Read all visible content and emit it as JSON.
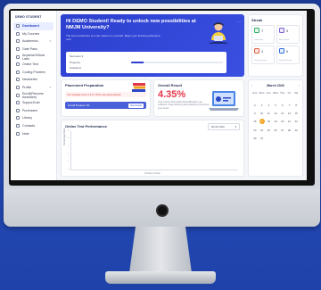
{
  "sidebar": {
    "brand": "DEMO STUDENT",
    "items": [
      {
        "label": "Dashboard",
        "active": true
      },
      {
        "label": "My Courses"
      },
      {
        "label": "Academics",
        "caret": true
      },
      {
        "label": "Gate Pass"
      },
      {
        "label": "Anydesk/Virtual Labs"
      },
      {
        "label": "Online Test"
      },
      {
        "label": "Coding Problem"
      },
      {
        "label": "Newsletter"
      },
      {
        "label": "Profile",
        "caret": true
      },
      {
        "label": "Enroll(Resume Assistant)"
      },
      {
        "label": "Support/Lab"
      },
      {
        "label": "Purchases"
      },
      {
        "label": "Library"
      },
      {
        "label": "Contacts"
      },
      {
        "label": "Note"
      }
    ]
  },
  "hero": {
    "title": "Hi DEMO Student! Ready to unlock new possibilities at NMJM University?",
    "subtitle": "The best investment you can make is in yourself. Begin your learning adventure now.",
    "rows": [
      {
        "label": "Semester 4",
        "value": ""
      },
      {
        "label": "Progress",
        "value": "",
        "progress": 0.14
      },
      {
        "label": "Academic",
        "value": ""
      }
    ]
  },
  "placement": {
    "title": "Placement Preparation",
    "alert": "Your average score is 0 %. Others are getting ahead.",
    "progress_label": "Overall Progress: 0%",
    "button": "View Details"
  },
  "result": {
    "title": "Overall Result",
    "value": "4.35%",
    "subtitle": "Your current Test performance/Result is not sufficient. Keep learning and practicing to improve your result."
  },
  "performance": {
    "title": "Online Test Performance",
    "select": "Month 2026",
    "y_label": "Percentage/Marks",
    "x_label": "Number of Tests",
    "ticks": [
      "5",
      "4",
      "3",
      "2",
      "1",
      "0"
    ]
  },
  "streak": {
    "title": "Streak",
    "tiles": [
      {
        "icon": "check-icon",
        "color": "#27ae60",
        "bg": "#e5f7ec",
        "value": "7",
        "caption": "Total Days"
      },
      {
        "icon": "trophy-icon",
        "color": "#7c5cd6",
        "bg": "#efe9fc",
        "value": "0",
        "caption": "Best Streak"
      },
      {
        "icon": "flame-icon",
        "color": "#e25c3b",
        "bg": "#fde9e4",
        "value": "1",
        "caption": "Current Streak"
      },
      {
        "icon": "star-icon",
        "color": "#2f6fdd",
        "bg": "#e6efff",
        "value": "0",
        "caption": "Reward Points"
      }
    ]
  },
  "calendar": {
    "month": "March 2026",
    "prev": "‹",
    "next": "›",
    "dow": [
      "Sun",
      "Mon",
      "Tue",
      "Wed",
      "Thu",
      "Fri",
      "Sat"
    ],
    "days": [
      "",
      "",
      "",
      "",
      "",
      "",
      "",
      "2",
      "3",
      "4",
      "5",
      "6",
      "7",
      "8",
      "9",
      "10",
      "11",
      "12",
      "13",
      "14",
      "15",
      "16",
      "17",
      "18",
      "19",
      "20",
      "21",
      "22",
      "23",
      "24",
      "25",
      "26",
      "27",
      "28",
      "29",
      "30",
      "31",
      "",
      "",
      "",
      "",
      ""
    ],
    "today": "17"
  }
}
